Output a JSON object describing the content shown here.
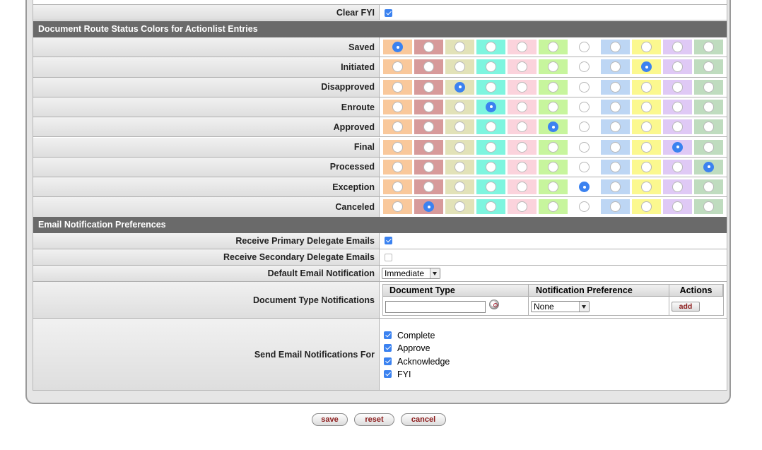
{
  "clear_fyi": {
    "label": "Clear FYI",
    "checked": true
  },
  "route_colors": {
    "header": "Document Route Status Colors for Actionlist Entries",
    "swatches": [
      "#f9c89b",
      "#d79a9a",
      "#e2e2b8",
      "#7ef5df",
      "#fbd3dc",
      "#c7f59d",
      "#ffffff",
      "#bdd6f4",
      "#fbf88f",
      "#dfc9f5",
      "#bfdcbf"
    ],
    "rows": [
      {
        "label": "Saved",
        "selected": 0
      },
      {
        "label": "Initiated",
        "selected": 8
      },
      {
        "label": "Disapproved",
        "selected": 2
      },
      {
        "label": "Enroute",
        "selected": 3
      },
      {
        "label": "Approved",
        "selected": 5
      },
      {
        "label": "Final",
        "selected": 9
      },
      {
        "label": "Processed",
        "selected": 10
      },
      {
        "label": "Exception",
        "selected": 6
      },
      {
        "label": "Canceled",
        "selected": 1
      }
    ]
  },
  "email": {
    "header": "Email Notification Preferences",
    "primary_delegate": {
      "label": "Receive Primary Delegate Emails",
      "checked": true
    },
    "secondary_delegate": {
      "label": "Receive Secondary Delegate Emails",
      "checked": false
    },
    "default_notification": {
      "label": "Default Email Notification",
      "value": "Immediate"
    },
    "doc_type_notifications": {
      "label": "Document Type Notifications",
      "columns": [
        "Document Type",
        "Notification Preference",
        "Actions"
      ],
      "doc_type_value": "",
      "preference_value": "None",
      "add_label": "add"
    },
    "send_for": {
      "label": "Send Email Notifications For",
      "options": [
        {
          "label": "Complete",
          "checked": true
        },
        {
          "label": "Approve",
          "checked": true
        },
        {
          "label": "Acknowledge",
          "checked": true
        },
        {
          "label": "FYI",
          "checked": true
        }
      ]
    }
  },
  "buttons": {
    "save": "save",
    "reset": "reset",
    "cancel": "cancel"
  }
}
